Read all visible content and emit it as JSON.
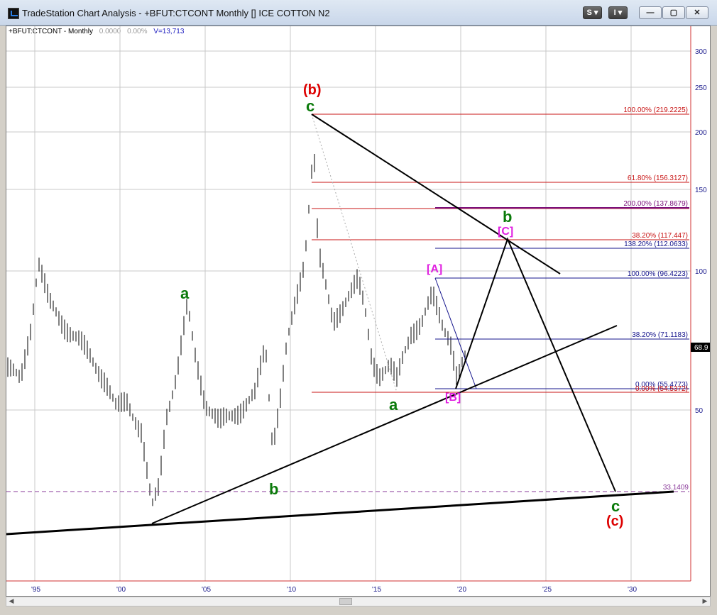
{
  "window": {
    "title": "TradeStation Chart Analysis - +BFUT:CTCONT Monthly [] ICE COTTON N2",
    "buttons": {
      "s_label": "S",
      "i_label": "I",
      "minimize": "—",
      "maximize": "▢",
      "close": "✕"
    }
  },
  "info": {
    "symbol": "+BFUT:CTCONT - Monthly",
    "val1": "0.0000",
    "val2": "0.00%",
    "volume": "V=13,713"
  },
  "colors": {
    "green": "#0a7a0a",
    "red": "#dd0000",
    "magenta": "#e020e0",
    "fib_red": "#c81414",
    "fib_blue": "#14148c",
    "price_axis": "#1a1a8c"
  },
  "price_axis": {
    "labels": [
      "300",
      "250",
      "200",
      "150",
      "100",
      "50"
    ],
    "current_price": "68.9"
  },
  "time_axis": {
    "labels": [
      "'95",
      "'00",
      "'05",
      "'10",
      "'15",
      "'20",
      "'25",
      "'30"
    ]
  },
  "fib_levels": [
    {
      "label": "100.00% (219.2225)",
      "color": "red"
    },
    {
      "label": "61.80% (156.3127)",
      "color": "red"
    },
    {
      "label": "200.00% (137.8679)",
      "color": "purple"
    },
    {
      "label": "38.20% (117.447)",
      "color": "red"
    },
    {
      "label": "138.20% (112.0633)",
      "color": "blue"
    },
    {
      "label": "100.00% (96.4223)",
      "color": "blue"
    },
    {
      "label": "38.20% (71.1183)",
      "color": "blue"
    },
    {
      "label": "0.00% (55.4773)",
      "color": "blue"
    },
    {
      "label": "0.00% (54.5372)",
      "color": "red"
    },
    {
      "label": "33.1409",
      "color": "purple"
    }
  ],
  "wave_labels": {
    "b_paren_top": "(b)",
    "c_top": "c",
    "a_2004": "a",
    "b_2009": "b",
    "a_2016": "a",
    "A_bracket": "[A]",
    "B_bracket": "[B]",
    "C_bracket": "[C]",
    "b_future": "b",
    "c_future": "c",
    "c_paren_future": "(c)"
  }
}
